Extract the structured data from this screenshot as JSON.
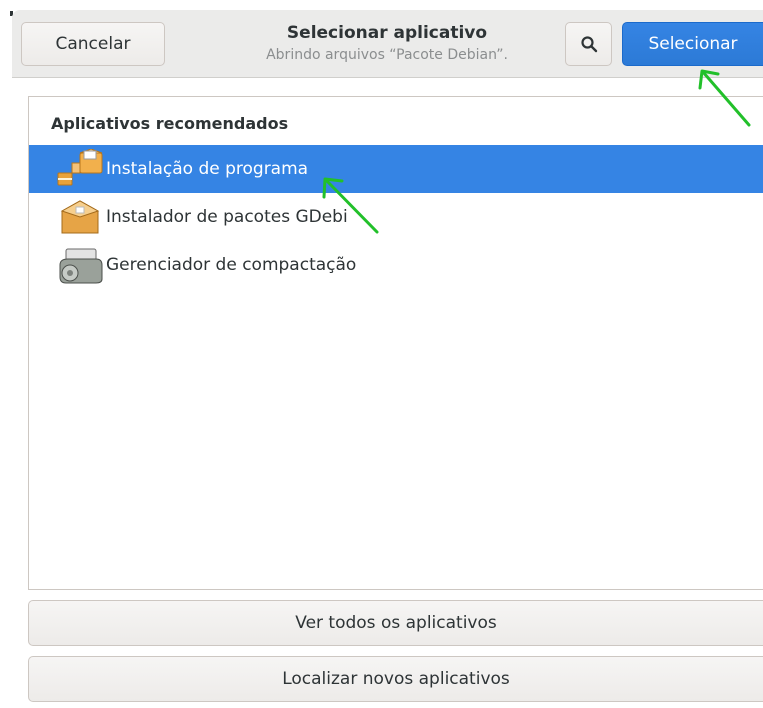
{
  "header": {
    "cancel_label": "Cancelar",
    "title": "Selecionar aplicativo",
    "subtitle": "Abrindo arquivos “Pacote Debian”.",
    "select_label": "Selecionar",
    "search_icon": "search-icon"
  },
  "list": {
    "heading": "Aplicativos recomendados",
    "items": [
      {
        "label": "Instalação de programa",
        "icon": "software-install-icon",
        "selected": true
      },
      {
        "label": "Instalador de pacotes GDebi",
        "icon": "package-box-icon",
        "selected": false
      },
      {
        "label": "Gerenciador de compactação",
        "icon": "archive-manager-icon",
        "selected": false
      }
    ]
  },
  "footer": {
    "view_all_label": "Ver todos os aplicativos",
    "find_new_label": "Localizar novos aplicativos"
  },
  "annotations": {
    "arrow_color": "#22c02a"
  },
  "colors": {
    "accent": "#3584e4",
    "header_bg": "#ebebea"
  }
}
